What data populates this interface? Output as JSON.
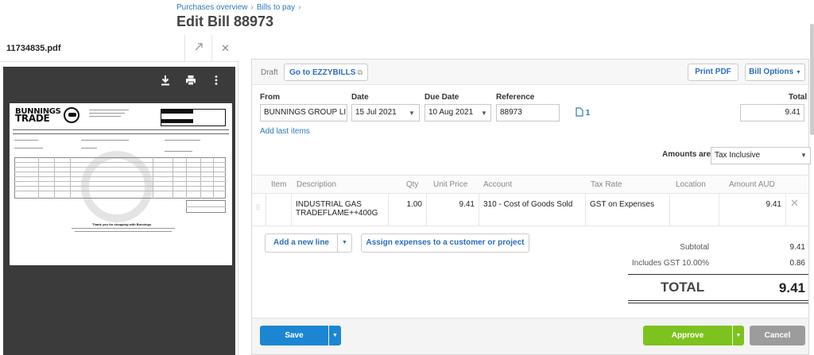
{
  "breadcrumb": {
    "item1": "Purchases overview",
    "item2": "Bills to pay",
    "sep": "›"
  },
  "page_title": "Edit Bill 88973",
  "pdf": {
    "filename": "11734835.pdf",
    "expand_icon": "expand-icon",
    "close_icon": "close-icon",
    "toolbar": {
      "download_icon": "download-icon",
      "print_icon": "print-icon",
      "more_icon": "more-vertical-icon"
    },
    "doc": {
      "logo_line1": "BUNNINGS",
      "logo_line2": "TRADE",
      "thanks": "Thank you for shopping with Bunnings"
    }
  },
  "status": "Draft",
  "buttons": {
    "ezzybills": "Go to EZZYBILLS",
    "print_pdf": "Print PDF",
    "bill_options": "Bill Options",
    "add_line": "Add a new line",
    "assign": "Assign expenses to a customer or project",
    "save": "Save",
    "approve": "Approve",
    "cancel": "Cancel"
  },
  "fields": {
    "from_label": "From",
    "from_value": "BUNNINGS GROUP LI",
    "date_label": "Date",
    "date_value": "15 Jul 2021",
    "due_label": "Due Date",
    "due_value": "10 Aug 2021",
    "ref_label": "Reference",
    "ref_value": "88973",
    "attach_count": "1",
    "total_label": "Total",
    "total_value": "9.41"
  },
  "add_last_items": "Add last items",
  "amounts_are": {
    "label": "Amounts are",
    "value": "Tax Inclusive"
  },
  "table": {
    "headers": [
      "Item",
      "Description",
      "Qty",
      "Unit Price",
      "Account",
      "Tax Rate",
      "Location",
      "Amount AUD"
    ],
    "rows": [
      {
        "item": "",
        "description": "INDUSTRIAL GAS TRADEFLAME++400G",
        "qty": "1.00",
        "unit_price": "9.41",
        "account": "310 - Cost of Goods Sold",
        "tax_rate": "GST on Expenses",
        "location": "",
        "amount": "9.41"
      }
    ]
  },
  "summary": {
    "subtotal_label": "Subtotal",
    "subtotal": "9.41",
    "gst_label": "Includes GST 10.00%",
    "gst": "0.86",
    "total_label": "TOTAL",
    "total": "9.41"
  },
  "colors": {
    "link": "#2a7bbf",
    "save": "#1c86d2",
    "approve": "#7dc21e",
    "cancel": "#9c9c9c",
    "viewer_bg": "#3b3b3b"
  }
}
